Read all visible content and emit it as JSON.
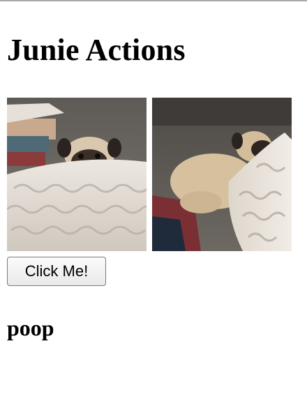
{
  "page": {
    "title": "Junie Actions"
  },
  "images": [
    {
      "name": "pug-on-couch-photo-1"
    },
    {
      "name": "pug-on-couch-photo-2"
    }
  ],
  "button": {
    "label": "Click Me!"
  },
  "output": {
    "text": "poop"
  }
}
